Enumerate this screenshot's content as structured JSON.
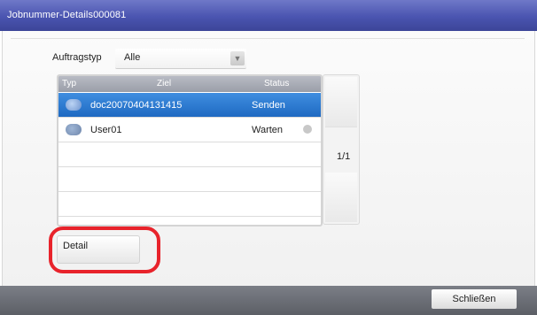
{
  "window": {
    "title": "Jobnummer-Details000081"
  },
  "filter": {
    "label": "Auftragstyp",
    "value": "Alle"
  },
  "table": {
    "headers": {
      "type": "Typ",
      "destination": "Ziel",
      "status": "Status"
    },
    "rows": [
      {
        "destination": "doc20070404131415",
        "status": "Senden",
        "selected": true
      },
      {
        "destination": "User01",
        "status": "Warten",
        "selected": false
      }
    ],
    "page": "1/1"
  },
  "buttons": {
    "detail": "Detail",
    "close": "Schließen"
  },
  "colors": {
    "titlebar": "#4a54b0",
    "selection": "#1f6ac2",
    "highlight": "#e8232b"
  }
}
